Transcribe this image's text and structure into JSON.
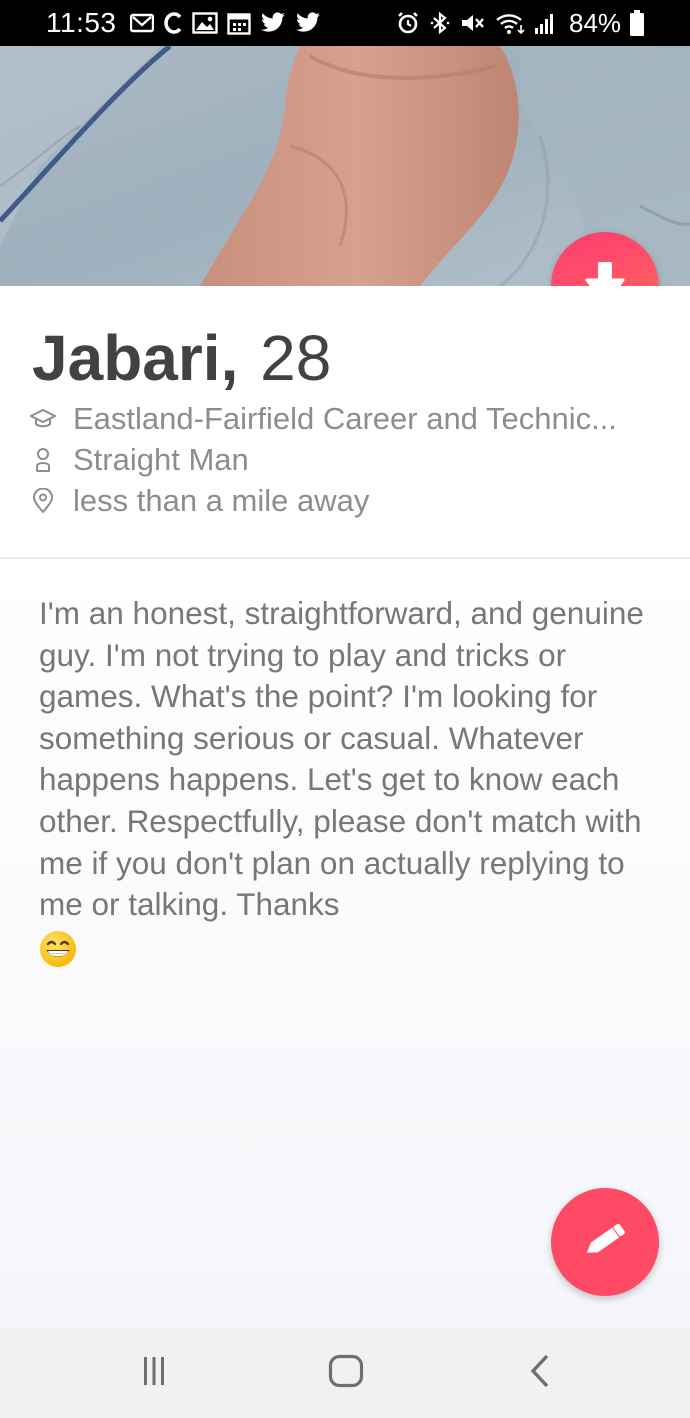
{
  "status_bar": {
    "time": "11:53",
    "left_icons": [
      "gmail-icon",
      "c-app-icon",
      "gallery-icon",
      "calendar-icon",
      "twitter-icon",
      "twitter-icon"
    ],
    "right_icons": [
      "alarm-icon",
      "bluetooth-icon",
      "mute-icon",
      "wifi-icon",
      "signal-icon"
    ],
    "battery": "84%"
  },
  "profile": {
    "name": "Jabari,",
    "age": "28",
    "school": "Eastland-Fairfield Career and Technic...",
    "orientation": "Straight Man",
    "distance": "less than a mile away",
    "bio": "I'm an honest, straightforward, and genuine guy. I'm not trying to play and tricks or games. What's the point? I'm looking for something serious or casual. Whatever happens happens. Let's get to know each other. Respectfully, please don't match with me if you don't plan on actually replying to me or talking. Thanks",
    "bio_emoji": "grinning-face-emoji"
  },
  "buttons": {
    "collapse": "arrow-down-icon",
    "edit": "pencil-icon"
  },
  "nav_bar": {
    "icons": [
      "recent-apps-icon",
      "home-icon",
      "back-icon"
    ]
  },
  "colors": {
    "accent": "#fe4a64",
    "gradient_start": "#fd3a73",
    "gradient_end": "#ff7854",
    "name_text": "#424242",
    "secondary_text": "#8d8d8d"
  }
}
